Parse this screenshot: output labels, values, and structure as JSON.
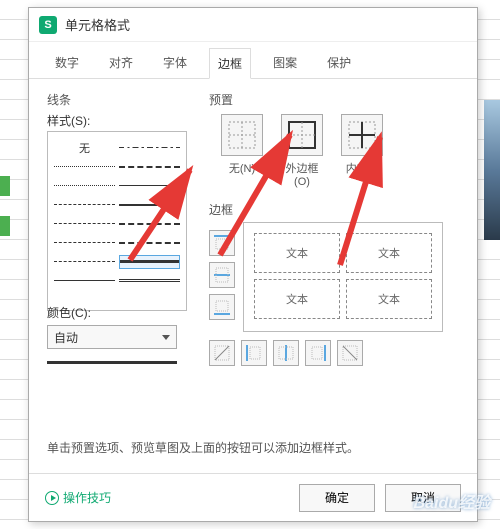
{
  "dialog": {
    "title": "单元格格式",
    "tabs": [
      "数字",
      "对齐",
      "字体",
      "边框",
      "图案",
      "保护"
    ],
    "active_tab": "边框"
  },
  "line": {
    "section": "线条",
    "style_label": "样式(S):",
    "none": "无",
    "color_label": "颜色(C):",
    "color_value": "自动"
  },
  "preset": {
    "section": "预置",
    "labels": [
      "无(N)",
      "外边框(O)",
      "内部(I)"
    ]
  },
  "border": {
    "section": "边框",
    "cell_text": "文本"
  },
  "hint": "单击预置选项、预览草图及上面的按钮可以添加边框样式。",
  "footer": {
    "tips": "操作技巧",
    "ok": "确定",
    "cancel": "取消"
  },
  "watermark": "Baidu经验"
}
